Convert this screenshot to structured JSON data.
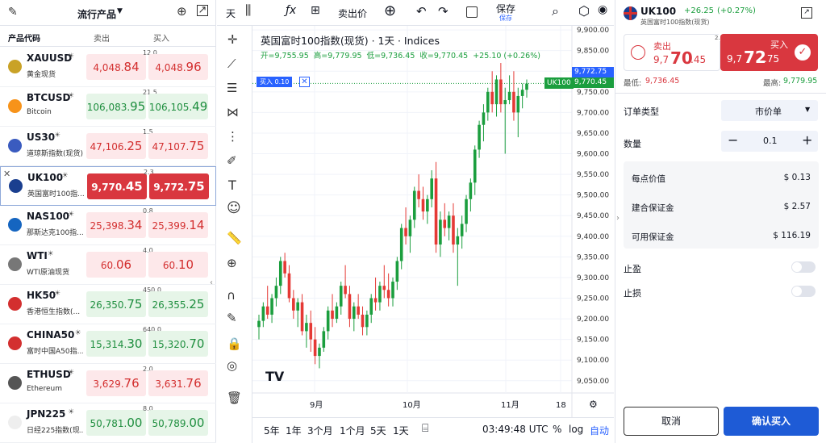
{
  "left_panel": {
    "title": "流行产品",
    "col_symbol": "产品代码",
    "col_sell": "卖出",
    "col_buy": "买入",
    "rows": [
      {
        "symbol": "XAUUSD",
        "name": "黄金现货",
        "spread": "12.0",
        "sell_a": "4,048.",
        "sell_b": "84",
        "buy_a": "4,048.",
        "buy_b": "96",
        "style": "red"
      },
      {
        "symbol": "BTCUSD",
        "name": "Bitcoin",
        "spread": "21.5",
        "sell_a": "106,083.",
        "sell_b": "95",
        "buy_a": "106,105.",
        "buy_b": "49",
        "style": "grn"
      },
      {
        "symbol": "US30",
        "name": "道琼斯指数(现货)",
        "spread": "1.5",
        "sell_a": "47,106.",
        "sell_b": "25",
        "buy_a": "47,107.",
        "buy_b": "75",
        "style": "red"
      },
      {
        "symbol": "UK100",
        "name": "英国富时100指...",
        "spread": "2.3",
        "sell_a": "9,770.",
        "sell_b": "45",
        "buy_a": "9,772.",
        "buy_b": "75",
        "style": "redsolid"
      },
      {
        "symbol": "NAS100",
        "name": "那斯达克100指...",
        "spread": "0.8",
        "sell_a": "25,398.",
        "sell_b": "34",
        "buy_a": "25,399.",
        "buy_b": "14",
        "style": "red"
      },
      {
        "symbol": "WTI",
        "name": "WTI原油现货",
        "spread": "4.0",
        "sell_a": "60.",
        "sell_b": "06",
        "buy_a": "60.",
        "buy_b": "10",
        "style": "red"
      },
      {
        "symbol": "HK50",
        "name": "香港恒生指数(...",
        "spread": "450.0",
        "sell_a": "26,350.",
        "sell_b": "75",
        "buy_a": "26,355.",
        "buy_b": "25",
        "style": "grn"
      },
      {
        "symbol": "CHINA50",
        "name": "富时中国A50指...",
        "spread": "640.0",
        "sell_a": "15,314.",
        "sell_b": "30",
        "buy_a": "15,320.",
        "buy_b": "70",
        "style": "grn"
      },
      {
        "symbol": "ETHUSD",
        "name": "Ethereum",
        "spread": "2.0",
        "sell_a": "3,629.",
        "sell_b": "76",
        "buy_a": "3,631.",
        "buy_b": "76",
        "style": "red"
      },
      {
        "symbol": "JPN225",
        "name": "日经225指数(现...",
        "spread": "8.0",
        "sell_a": "50,781.",
        "sell_b": "00",
        "buy_a": "50,789.",
        "buy_b": "00",
        "style": "grn"
      }
    ]
  },
  "toolbar": {
    "interval": "天",
    "buy_sell": "卖出价",
    "save": "保存",
    "save_sub": "保存"
  },
  "chart_header": {
    "title": "英国富时100指数(现货) · 1天 · Indices",
    "ohlc": "开=9,755.95  高=9,779.95  低=9,736.45  收=9,770.45  +25.10 (+0.26%)",
    "buy_tag": "买入 0.10",
    "price_tag_buy": "9,772.75",
    "price_tag_sell": "9,770.45",
    "symbol_tag": "UK100"
  },
  "chart_data": {
    "type": "candlestick",
    "y_ticks": [
      "9,900.00",
      "9,850.00",
      "9,800.00",
      "9,750.00",
      "9,700.00",
      "9,650.00",
      "9,600.00",
      "9,550.00",
      "9,500.00",
      "9,450.00",
      "9,400.00",
      "9,350.00",
      "9,300.00",
      "9,250.00",
      "9,200.00",
      "9,150.00",
      "9,100.00",
      "9,050.00"
    ],
    "x_ticks": [
      "9月",
      "10月",
      "11月",
      "18"
    ],
    "ylim": [
      9030,
      9910
    ],
    "up_color": "#26a69a",
    "up_color_actual": "#1b9e3e",
    "down_color": "#e53935",
    "candles": [
      [
        9180,
        9210,
        9150,
        9195
      ],
      [
        9195,
        9240,
        9180,
        9230
      ],
      [
        9230,
        9280,
        9200,
        9210
      ],
      [
        9210,
        9260,
        9190,
        9250
      ],
      [
        9250,
        9300,
        9230,
        9280
      ],
      [
        9280,
        9350,
        9260,
        9340
      ],
      [
        9340,
        9360,
        9300,
        9310
      ],
      [
        9310,
        9330,
        9240,
        9250
      ],
      [
        9250,
        9270,
        9200,
        9220
      ],
      [
        9220,
        9250,
        9180,
        9240
      ],
      [
        9240,
        9260,
        9160,
        9170
      ],
      [
        9170,
        9210,
        9130,
        9190
      ],
      [
        9190,
        9220,
        9120,
        9150
      ],
      [
        9150,
        9180,
        9090,
        9110
      ],
      [
        9110,
        9140,
        9080,
        9130
      ],
      [
        9130,
        9180,
        9120,
        9170
      ],
      [
        9170,
        9230,
        9150,
        9220
      ],
      [
        9220,
        9260,
        9180,
        9200
      ],
      [
        9200,
        9240,
        9190,
        9230
      ],
      [
        9230,
        9290,
        9210,
        9280
      ],
      [
        9280,
        9330,
        9250,
        9260
      ],
      [
        9260,
        9280,
        9180,
        9200
      ],
      [
        9200,
        9240,
        9170,
        9230
      ],
      [
        9230,
        9260,
        9200,
        9210
      ],
      [
        9210,
        9230,
        9160,
        9180
      ],
      [
        9180,
        9220,
        9160,
        9210
      ],
      [
        9210,
        9260,
        9190,
        9250
      ],
      [
        9250,
        9300,
        9220,
        9240
      ],
      [
        9240,
        9290,
        9220,
        9280
      ],
      [
        9280,
        9330,
        9250,
        9270
      ],
      [
        9270,
        9310,
        9230,
        9250
      ],
      [
        9250,
        9300,
        9230,
        9290
      ],
      [
        9290,
        9350,
        9270,
        9340
      ],
      [
        9340,
        9430,
        9320,
        9420
      ],
      [
        9420,
        9470,
        9380,
        9400
      ],
      [
        9400,
        9450,
        9360,
        9440
      ],
      [
        9440,
        9520,
        9420,
        9510
      ],
      [
        9510,
        9550,
        9470,
        9490
      ],
      [
        9490,
        9520,
        9440,
        9460
      ],
      [
        9460,
        9500,
        9430,
        9490
      ],
      [
        9490,
        9560,
        9470,
        9540
      ],
      [
        9540,
        9580,
        9360,
        9380
      ],
      [
        9380,
        9460,
        9350,
        9440
      ],
      [
        9440,
        9480,
        9400,
        9420
      ],
      [
        9420,
        9460,
        9390,
        9450
      ],
      [
        9450,
        9480,
        9360,
        9380
      ],
      [
        9380,
        9420,
        9280,
        9400
      ],
      [
        9400,
        9450,
        9370,
        9430
      ],
      [
        9430,
        9500,
        9410,
        9490
      ],
      [
        9490,
        9540,
        9460,
        9530
      ],
      [
        9530,
        9620,
        9500,
        9610
      ],
      [
        9610,
        9680,
        9590,
        9670
      ],
      [
        9670,
        9720,
        9630,
        9700
      ],
      [
        9700,
        9760,
        9680,
        9750
      ],
      [
        9750,
        9800,
        9700,
        9720
      ],
      [
        9720,
        9790,
        9690,
        9780
      ],
      [
        9780,
        9820,
        9700,
        9720
      ],
      [
        9720,
        9760,
        9600,
        9730
      ],
      [
        9730,
        9790,
        9720,
        9750
      ],
      [
        9750,
        9800,
        9680,
        9700
      ],
      [
        9700,
        9760,
        9640,
        9740
      ],
      [
        9740,
        9770,
        9710,
        9755
      ],
      [
        9755,
        9780,
        9736,
        9770
      ]
    ]
  },
  "bottom": {
    "ranges": [
      "5年",
      "1年",
      "3个月",
      "1个月",
      "5天",
      "1天"
    ],
    "time": "03:49:48 UTC",
    "pct": "%",
    "log": "log",
    "auto": "自动"
  },
  "order_panel": {
    "symbol": "UK100",
    "change": "+26.25",
    "change_pct": "(+0.27%)",
    "name": "英国富时100指数(现货)",
    "sell_label": "卖出",
    "sell_a": "9,7",
    "sell_b": "70",
    "sell_c": ".45",
    "buy_label": "买入",
    "buy_a": "9,7",
    "buy_b": "72",
    "buy_c": ".75",
    "spread": "2.3",
    "low_label": "最低:",
    "low": "9,736.45",
    "high_label": "最高:",
    "high": "9,779.95",
    "order_type_label": "订单类型",
    "order_type": "市价单",
    "qty_label": "数量",
    "qty": "0.1",
    "point_value_label": "每点价值",
    "point_value": "$ 0.13",
    "margin_label": "建合保证金",
    "margin": "$ 2.57",
    "avail_label": "可用保证金",
    "avail": "$ 116.19",
    "tp_label": "止盈",
    "sl_label": "止损",
    "cancel": "取消",
    "confirm": "确认买入"
  }
}
